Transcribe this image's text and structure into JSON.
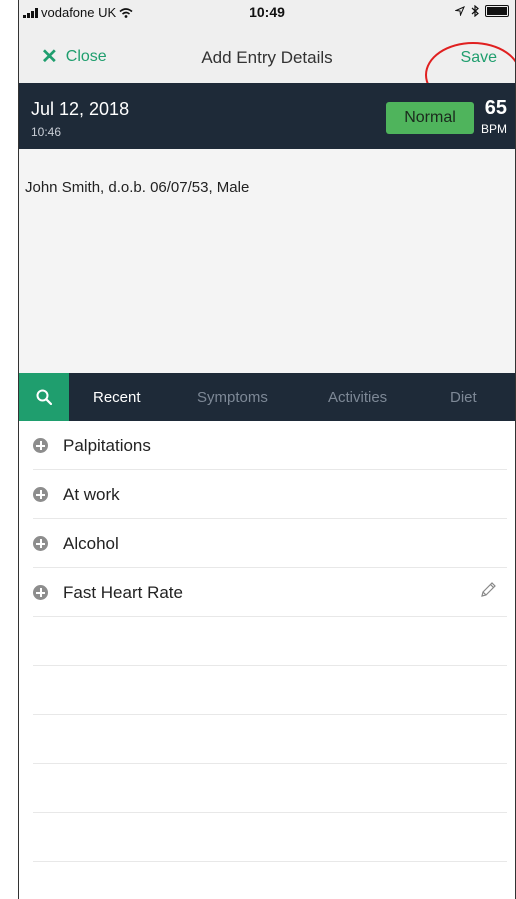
{
  "status_bar": {
    "carrier": "vodafone UK",
    "time": "10:49"
  },
  "nav": {
    "close_label": "Close",
    "title": "Add Entry Details",
    "save_label": "Save"
  },
  "entry": {
    "date": "Jul 12, 2018",
    "time": "10:46",
    "status": "Normal",
    "bpm_value": "65",
    "bpm_unit": "BPM"
  },
  "notes": {
    "text": "John Smith, d.o.b. 06/07/53, Male"
  },
  "tabs": [
    {
      "label": "Recent",
      "active": true
    },
    {
      "label": "Symptoms",
      "active": false
    },
    {
      "label": "Activities",
      "active": false
    },
    {
      "label": "Diet",
      "active": false
    }
  ],
  "items": [
    {
      "label": "Palpitations"
    },
    {
      "label": "At work"
    },
    {
      "label": "Alcohol"
    },
    {
      "label": "Fast Heart Rate"
    }
  ],
  "colors": {
    "accent": "#1f9e6e",
    "header_bg": "#1e2a38",
    "status_normal": "#4fb45c",
    "highlight_ring": "#e02020"
  }
}
